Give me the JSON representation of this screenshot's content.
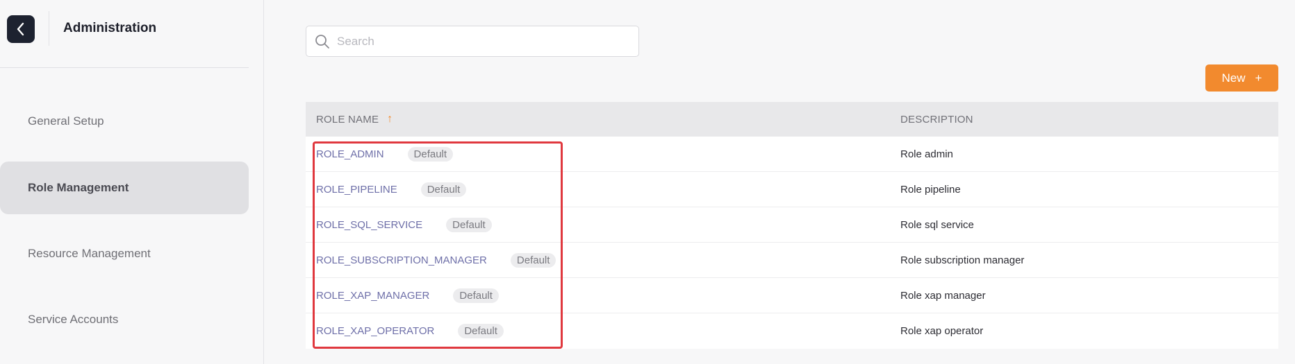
{
  "sidebar": {
    "title": "Administration",
    "items": [
      {
        "label": "General Setup",
        "active": false
      },
      {
        "label": "Role Management",
        "active": true
      },
      {
        "label": "Resource Management",
        "active": false
      },
      {
        "label": "Service Accounts",
        "active": false
      }
    ]
  },
  "search": {
    "placeholder": "Search",
    "value": ""
  },
  "toolbar": {
    "new_label": "New",
    "new_icon": "+"
  },
  "table": {
    "columns": {
      "role_name": "ROLE NAME",
      "description": "DESCRIPTION"
    },
    "sort_icon": "↑",
    "rows": [
      {
        "role": "ROLE_ADMIN",
        "badge": "Default",
        "description": "Role admin"
      },
      {
        "role": "ROLE_PIPELINE",
        "badge": "Default",
        "description": "Role pipeline"
      },
      {
        "role": "ROLE_SQL_SERVICE",
        "badge": "Default",
        "description": "Role sql service"
      },
      {
        "role": "ROLE_SUBSCRIPTION_MANAGER",
        "badge": "Default",
        "description": "Role subscription manager"
      },
      {
        "role": "ROLE_XAP_MANAGER",
        "badge": "Default",
        "description": "Role xap manager"
      },
      {
        "role": "ROLE_XAP_OPERATOR",
        "badge": "Default",
        "description": "Role xap operator"
      }
    ]
  },
  "colors": {
    "accent": "#f28a2e",
    "link": "#6e6fa8",
    "highlight": "#e0383e",
    "back_button": "#1d2230"
  }
}
